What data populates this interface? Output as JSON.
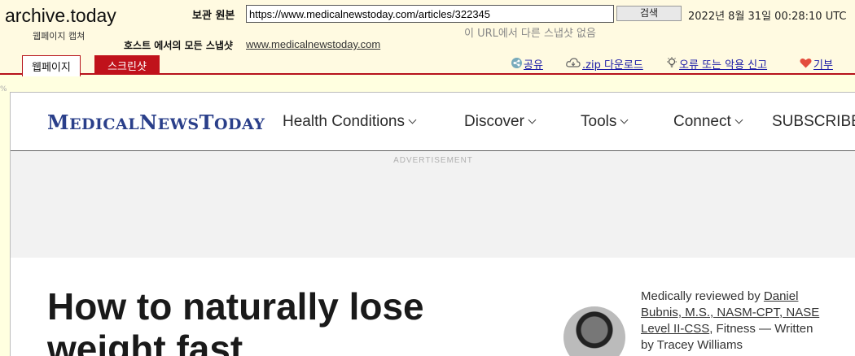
{
  "archive": {
    "logo": "archive.today",
    "logo_sub": "웹페이지 캡쳐",
    "original_label": "보관 원본",
    "url_value": "https://www.medicalnewstoday.com/articles/322345",
    "search_label": "검색",
    "datetime": "2022년 8월 31일 00:28:10 UTC",
    "no_other_snapshots": "이 URL에서 다른 스냅샷 없음",
    "host_label": "호스트 에서의 모든 스냅샷",
    "host_link": "www.medicalnewstoday.com",
    "tabs": {
      "webpage": "웹페이지",
      "screenshot": "스크린샷"
    },
    "actions": {
      "share": "공유",
      "zip": ".zip 다운로드",
      "report": "오류 또는 악용 신고",
      "donate": "기부"
    },
    "colors": {
      "accent": "#b6121b",
      "header_bg": "#fffae1",
      "link": "#1a1aa6"
    }
  },
  "site": {
    "logo_parts": [
      "M",
      "EDICAL",
      "N",
      "EWS",
      "T",
      "ODAY"
    ],
    "nav": {
      "health": "Health Conditions",
      "discover": "Discover",
      "tools": "Tools",
      "connect": "Connect",
      "subscribe": "SUBSCRIBE"
    },
    "ad_label": "ADVERTISEMENT",
    "headline": "How to naturally lose weight fast",
    "byline": {
      "prefix": "Medically reviewed by ",
      "reviewer": "Daniel Bubnis, M.S., NASM-CPT, NASE Level II-CSS",
      "mid": ", Fitness — Written by Tracey Williams"
    },
    "colors": {
      "logo": "#2a3f8a"
    }
  },
  "misc": {
    "pct_mark": "%"
  }
}
